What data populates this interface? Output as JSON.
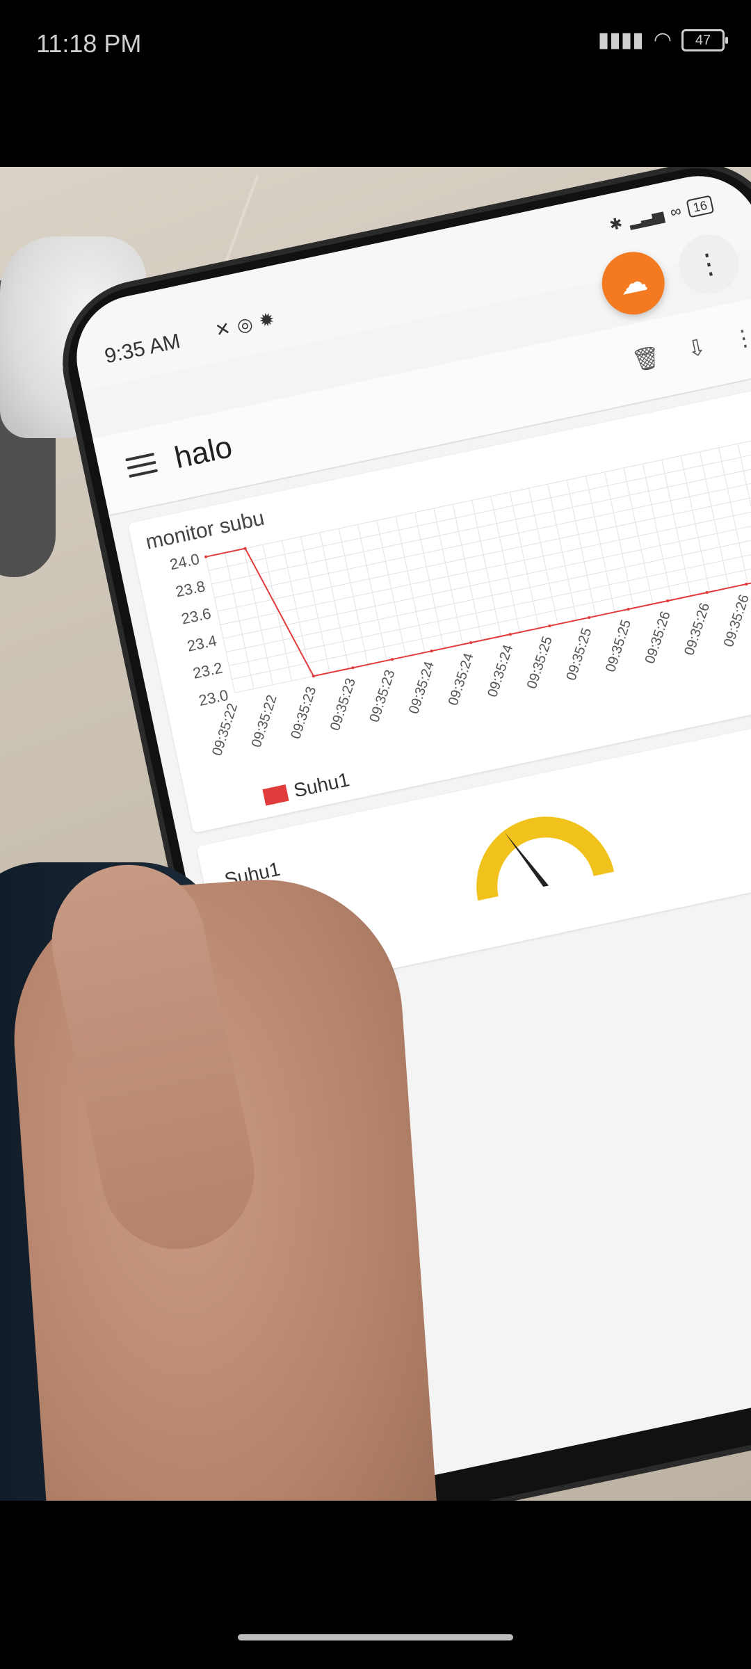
{
  "outer_status": {
    "time": "11:18 PM",
    "battery": "47"
  },
  "inner_status": {
    "time": "9:35 AM",
    "battery": "16"
  },
  "app": {
    "title": "halo",
    "chart_card_title": "monitor subu",
    "legend_label": "Suhu1",
    "gauge_label": "Suhu1",
    "gauge_value": "23",
    "toolbar_icons": [
      "trash-icon",
      "cloud-download-icon",
      "more-vert-icon"
    ]
  },
  "chart_data": {
    "type": "line",
    "title": "monitor subu",
    "x": [
      "09:35:22",
      "09:35:22",
      "09:35:23",
      "09:35:23",
      "09:35:23",
      "09:35:24",
      "09:35:24",
      "09:35:24",
      "09:35:25",
      "09:35:25",
      "09:35:25",
      "09:35:26",
      "09:35:26",
      "09:35:26",
      "09:35:26"
    ],
    "series": [
      {
        "name": "Suhu1",
        "values": [
          24.0,
          24.0,
          23.0,
          23.0,
          23.0,
          23.0,
          23.0,
          23.0,
          23.0,
          23.0,
          23.0,
          23.0,
          23.0,
          23.0,
          23.0
        ]
      }
    ],
    "y_ticks": [
      "24.0",
      "23.8",
      "23.6",
      "23.4",
      "23.2",
      "23.0"
    ],
    "ylim": [
      23.0,
      24.0
    ],
    "grid": true,
    "legend": "bottom-left",
    "colors": {
      "Suhu1": "#e23b3b"
    }
  }
}
